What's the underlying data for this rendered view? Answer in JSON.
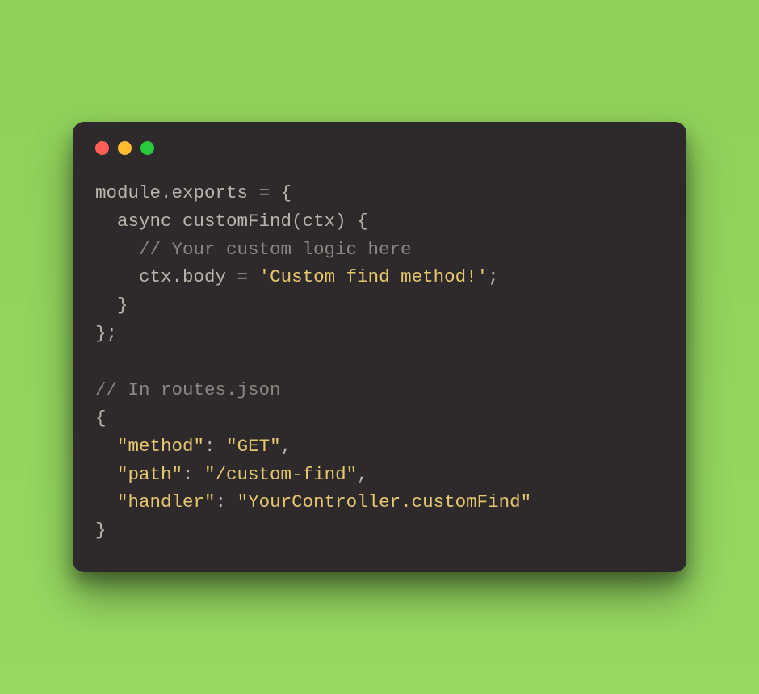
{
  "theme": {
    "page_bg": "#92d45e",
    "window_bg": "#2e2a2b",
    "text_base": "#b9b5ac",
    "text_string": "#e6c86e",
    "text_comment": "#8a8782",
    "traffic_red": "#ff5f56",
    "traffic_yellow": "#ffbd2e",
    "traffic_green": "#27c93f"
  },
  "traffic": {
    "red": "close",
    "yellow": "minimize",
    "green": "zoom"
  },
  "code": {
    "l1_a": "module",
    "l1_b": ".",
    "l1_c": "exports",
    "l1_d": " = {",
    "l2_a": "  async ",
    "l2_b": "customFind",
    "l2_c": "(ctx) {",
    "l3": "    // Your custom logic here",
    "l4_a": "    ctx",
    "l4_b": ".",
    "l4_c": "body",
    "l4_d": " = ",
    "l4_e": "'Custom find method!'",
    "l4_f": ";",
    "l5": "  }",
    "l6": "};",
    "l7": "",
    "l8": "// In routes.json",
    "l9": "{",
    "l10_a": "  ",
    "l10_b": "\"method\"",
    "l10_c": ": ",
    "l10_d": "\"GET\"",
    "l10_e": ",",
    "l11_a": "  ",
    "l11_b": "\"path\"",
    "l11_c": ": ",
    "l11_d": "\"/custom-find\"",
    "l11_e": ",",
    "l12_a": "  ",
    "l12_b": "\"handler\"",
    "l12_c": ": ",
    "l12_d": "\"YourController.customFind\"",
    "l13": "}"
  }
}
